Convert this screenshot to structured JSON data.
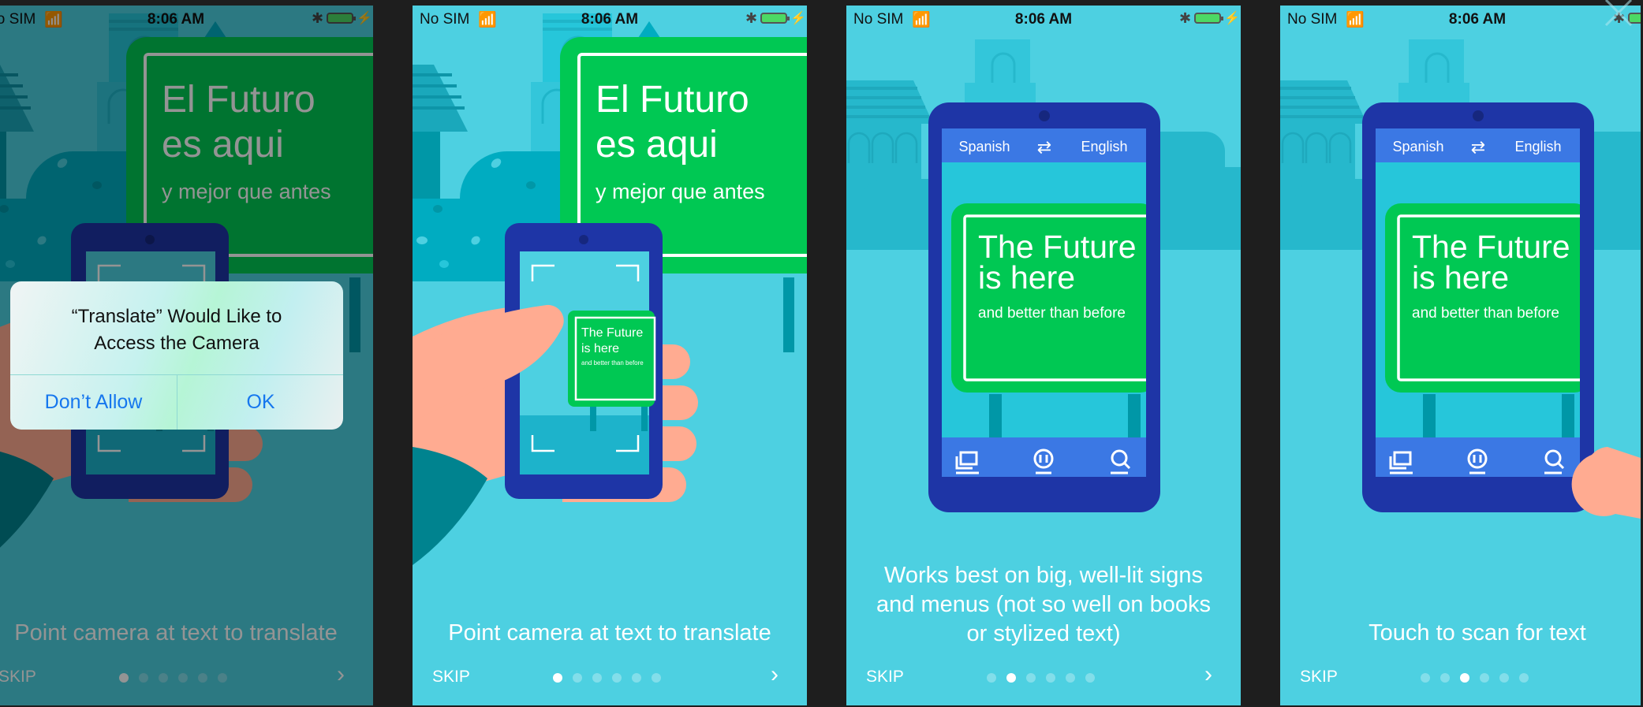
{
  "status_bar": {
    "carrier": "No SIM",
    "time": "8:06 AM",
    "battery_charging": true
  },
  "colors": {
    "background_teal": "#4dd0e1",
    "sign_green": "#00c853",
    "phone_frame": "#1e35a6",
    "app_bar_blue": "#3b78e4",
    "hand": "#ffab91",
    "alert_button_blue": "#1677ee"
  },
  "sign": {
    "spanish_line1": "El Futuro",
    "spanish_line2": "es aqui",
    "spanish_line3": "y mejor que antes",
    "english_line1": "The Future",
    "english_line2": "is here",
    "english_line3": "and better than before"
  },
  "app": {
    "source_language": "Spanish",
    "target_language": "English",
    "swap_icon": "swap-arrows-icon",
    "toolbar_icons": [
      "gallery-icon",
      "pause-icon",
      "scan-search-icon"
    ]
  },
  "onboarding": {
    "skip_label": "SKIP",
    "next_icon": "chevron-right-icon",
    "page_count": 6,
    "screens": [
      {
        "caption": "Point camera at text to translate",
        "active_page": 1,
        "dimmed": true
      },
      {
        "caption": "Point camera at text to translate",
        "active_page": 1,
        "dimmed": false
      },
      {
        "caption": "Works best on big, well-lit signs and menus (not so well on books or stylized text)",
        "caption_lines": [
          "Works best on big, well-lit signs",
          "and menus (not so well on books",
          "or stylized text)"
        ],
        "active_page": 2,
        "dimmed": false
      },
      {
        "caption": "Touch to scan for text",
        "active_page": 3,
        "dimmed": false
      }
    ]
  },
  "alert": {
    "title_line1": "“Translate” Would Like to",
    "title_line2": "Access the Camera",
    "deny_label": "Don’t Allow",
    "ok_label": "OK"
  }
}
